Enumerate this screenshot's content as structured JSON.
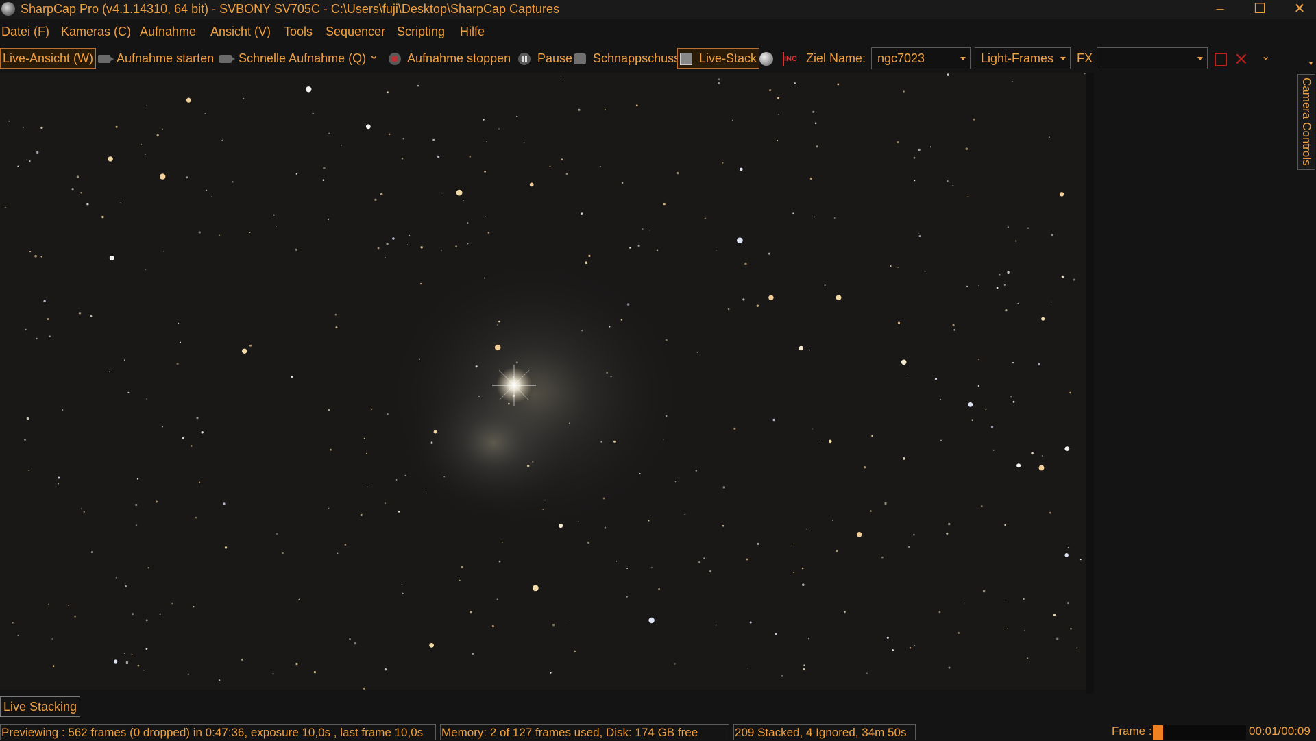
{
  "window": {
    "title": "SharpCap Pro (v4.1.14310, 64 bit) - SVBONY SV705C - C:\\Users\\fuji\\Desktop\\SharpCap Captures",
    "minimize": "–",
    "maximize": "☐",
    "close": "✕"
  },
  "menu": [
    "Datei (F)",
    "Kameras (C)",
    "Aufnahme",
    "Ansicht (V)",
    "Tools",
    "Sequencer",
    "Scripting",
    "Hilfe"
  ],
  "toolbar": {
    "live_view": "Live-Ansicht (W)",
    "start_capture": "Aufnahme starten",
    "quick_capture": "Schnelle Aufnahme (Q)",
    "quick_capture_arrow": "⌄",
    "stop_capture": "Aufnahme stoppen",
    "pause": "Pause",
    "snapshot": "Schnappschuss",
    "live_stack": "Live-Stack",
    "inc_icon": "INC",
    "target_label": "Ziel Name:",
    "target_value": "ngc7023",
    "frame_type": "Light-Frames",
    "fx_label": "FX",
    "fx_value": "",
    "overflow": "⌄",
    "x_icon": "⨯"
  },
  "icons": {
    "app": "sharpcap-icon",
    "moon": "moon-icon",
    "inc": "inc-icon",
    "square": "red-square-icon",
    "x": "red-x-icon"
  },
  "side_panel": {
    "camera_controls_tab": "Camera Controls",
    "corner_mark": "▾"
  },
  "bottom": {
    "live_stacking_tab": "Live Stacking"
  },
  "status": {
    "preview": "Previewing : 562 frames (0 dropped) in 0:47:36, exposure 10,0s , last frame 10,0s",
    "memory": "Memory: 2 of 127 frames used, Disk: 174 GB free",
    "stack": "209 Stacked, 4 Ignored, 34m 50s",
    "frame_label": "Frame :",
    "frame_time": "00:01/00:09",
    "frame_progress": 0.11
  },
  "colors": {
    "accent": "#f0a040",
    "background": "#141414",
    "image_bg": "#191817",
    "danger": "#c02020"
  }
}
